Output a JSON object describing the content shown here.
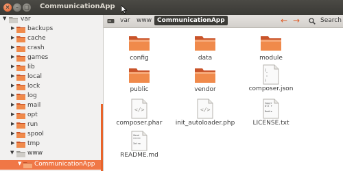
{
  "window": {
    "title": "CommunicationApp"
  },
  "sidebar": {
    "root": "var",
    "folders": [
      "backups",
      "cache",
      "crash",
      "games",
      "lib",
      "local",
      "lock",
      "log",
      "mail",
      "opt",
      "run",
      "spool",
      "tmp",
      "www"
    ],
    "selected": "CommunicationApp"
  },
  "breadcrumb": [
    "var",
    "www",
    "CommunicationApp"
  ],
  "toolbar": {
    "search_label": "Search"
  },
  "files": [
    {
      "name": "config",
      "type": "folder"
    },
    {
      "name": "data",
      "type": "folder"
    },
    {
      "name": "module",
      "type": "folder"
    },
    {
      "name": "public",
      "type": "folder"
    },
    {
      "name": "vendor",
      "type": "folder"
    },
    {
      "name": "composer.json",
      "type": "text"
    },
    {
      "name": "composer.phar",
      "type": "code"
    },
    {
      "name": "init_autoloader.php",
      "type": "code"
    },
    {
      "name": "LICENSE.txt",
      "type": "text"
    },
    {
      "name": "README.md",
      "type": "text"
    }
  ],
  "file_thumb_text": {
    "composer_json": "{\n  \"\n  \"\n  \"\n}",
    "license_txt": "Copyr\nAll r\n\nRedis",
    "readme_md": "Zend\n=====\n\nIntro"
  },
  "colors": {
    "accent": "#f07746",
    "folder": "#f08a4b",
    "titlebar": "#3c3b37"
  }
}
